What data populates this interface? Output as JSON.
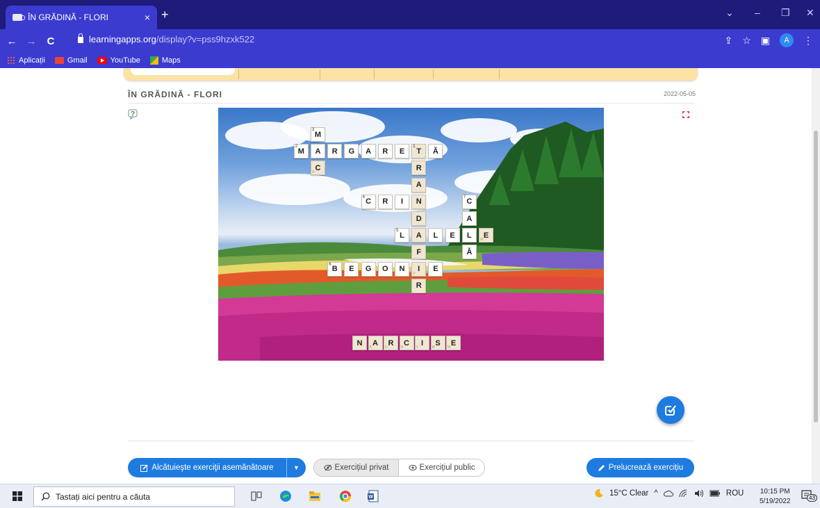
{
  "browser": {
    "tab_title": "ÎN GRĂDINĂ - FLORI",
    "tab_close": "×",
    "new_tab": "+",
    "url_host": "learningapps.org",
    "url_path": "/display?v=pss9hzxk522",
    "profile_initial": "A",
    "window_controls": [
      "⌄",
      "–",
      "❐",
      "✕"
    ],
    "nav": [
      "←",
      "→",
      "C"
    ],
    "toolbar_icons": [
      "⇪",
      "☆",
      "▣",
      "⋮"
    ],
    "bookmarks": [
      "Aplicații",
      "Gmail",
      "YouTube",
      "Maps"
    ]
  },
  "exercise": {
    "title": "ÎN GRĂDINĂ - FLORI",
    "date": "2022-05-05"
  },
  "crossword": {
    "cells": [
      {
        "l": "M",
        "n": "3",
        "c": 7,
        "r": 1
      },
      {
        "l": "M",
        "n": "2",
        "c": 6,
        "r": 2
      },
      {
        "l": "A",
        "c": 7,
        "r": 2
      },
      {
        "l": "R",
        "c": 8,
        "r": 2
      },
      {
        "l": "G",
        "c": 9,
        "r": 2
      },
      {
        "l": "A",
        "c": 10,
        "r": 2
      },
      {
        "l": "R",
        "c": 11,
        "r": 2
      },
      {
        "l": "E",
        "c": 12,
        "r": 2
      },
      {
        "l": "T",
        "n": "1",
        "c": 13,
        "r": 2,
        "shade": true
      },
      {
        "l": "Ă",
        "c": 14,
        "r": 2
      },
      {
        "l": "C",
        "c": 7,
        "r": 3,
        "shade": true,
        "sm": "N"
      },
      {
        "l": "R",
        "c": 13,
        "r": 3,
        "shade": true
      },
      {
        "l": "A",
        "c": 13,
        "r": 4,
        "shade": true
      },
      {
        "l": "C",
        "n": "4",
        "c": 10,
        "r": 5
      },
      {
        "l": "R",
        "c": 11,
        "r": 5
      },
      {
        "l": "I",
        "c": 12,
        "r": 5
      },
      {
        "l": "N",
        "c": 13,
        "r": 5,
        "shade": true
      },
      {
        "l": "C",
        "n": "7",
        "c": 16,
        "r": 5
      },
      {
        "l": "D",
        "c": 13,
        "r": 6,
        "shade": true
      },
      {
        "l": "A",
        "c": 16,
        "r": 6
      },
      {
        "l": "L",
        "n": "5",
        "c": 12,
        "r": 7
      },
      {
        "l": "A",
        "c": 13,
        "r": 7,
        "shade": true
      },
      {
        "l": "L",
        "c": 14,
        "r": 7
      },
      {
        "l": "E",
        "c": 15,
        "r": 7
      },
      {
        "l": "L",
        "c": 16,
        "r": 7
      },
      {
        "l": "E",
        "c": 17,
        "r": 7,
        "shade": true,
        "sm": "W"
      },
      {
        "l": "F",
        "c": 13,
        "r": 8,
        "shade": true
      },
      {
        "l": "Ă",
        "c": 16,
        "r": 8
      },
      {
        "l": "B",
        "n": "6",
        "c": 8,
        "r": 9
      },
      {
        "l": "E",
        "c": 9,
        "r": 9
      },
      {
        "l": "G",
        "c": 10,
        "r": 9
      },
      {
        "l": "O",
        "c": 11,
        "r": 9
      },
      {
        "l": "N",
        "c": 12,
        "r": 9
      },
      {
        "l": "I",
        "c": 13,
        "r": 9,
        "shade": true,
        "sm": "V"
      },
      {
        "l": "E",
        "c": 14,
        "r": 9
      },
      {
        "l": "R",
        "c": 13,
        "r": 10,
        "shade": true
      }
    ],
    "tray_letters": [
      {
        "l": "N",
        "sm": ""
      },
      {
        "l": "A",
        "sm": "A"
      },
      {
        "l": "R",
        "sm": "G"
      },
      {
        "l": "C",
        "sm": "N"
      },
      {
        "l": "I",
        "sm": "V"
      },
      {
        "l": "S",
        "sm": "M"
      },
      {
        "l": "E",
        "sm": "W"
      }
    ]
  },
  "actions": {
    "similar_label": "Alcătuieşte exerciţii asemănătoare",
    "private_label": "Exercițiul privat",
    "public_label": "Exercițiul public",
    "edit_label": "Prelucrează exercițiu"
  },
  "taskbar": {
    "search_placeholder": "Tastați aici pentru a căuta",
    "weather": "15°C  Clear",
    "language": "ROU",
    "time": "10:15 PM",
    "date": "5/19/2022",
    "notif_count": "43"
  },
  "colors": {
    "chrome_dark": "#1f1b7a",
    "chrome": "#3b3bd0",
    "accent": "#1e7be0",
    "banner": "#fce2a5"
  }
}
